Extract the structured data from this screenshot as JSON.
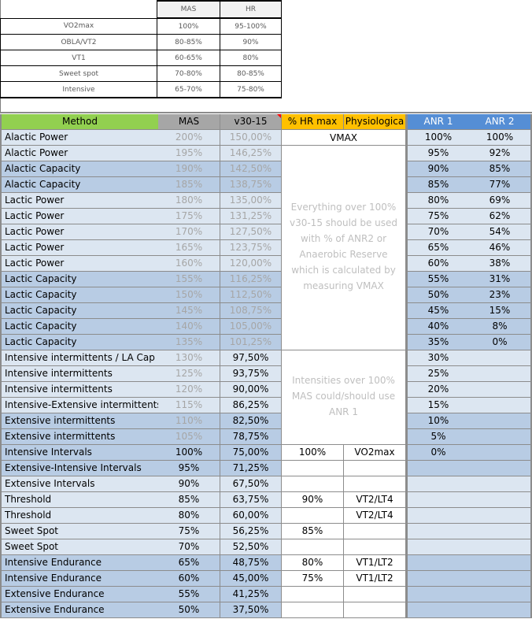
{
  "reference_table": {
    "headers": [
      "",
      "MAS",
      "HR"
    ],
    "rows": [
      {
        "label": "VO2max",
        "mas": "100%",
        "hr": "95-100%"
      },
      {
        "label": "OBLA/VT2",
        "mas": "80-85%",
        "hr": "90%"
      },
      {
        "label": "VT1",
        "mas": "60-65%",
        "hr": "80%"
      },
      {
        "label": "Sweet spot",
        "mas": "70-80%",
        "hr": "80-85%"
      },
      {
        "label": "Intensive",
        "mas": "65-70%",
        "hr": "75-80%"
      }
    ]
  },
  "main_table": {
    "headers": {
      "method": "Method",
      "mas": "MAS",
      "v30": "v30-15",
      "hr": "% HR max",
      "phys": "Physiologica",
      "anr1": "ANR 1",
      "anr2": "ANR 2"
    },
    "colors": {
      "method_header": "#92d050",
      "gray_header": "#a6a6a6",
      "orange_header": "#ffc000",
      "blue_header": "#558ed5",
      "row_light": "#dce6f1",
      "row_dark": "#b8cce4"
    },
    "merged_notes": {
      "vmax": "VMAX",
      "anr2_note": "Everything over 100% v30-15 should be used with % of ANR2 or Anaerobic Reserve which is calculated by measuring VMAX",
      "anr1_note": "Intensities over 100% MAS could/should use ANR 1"
    },
    "rows": [
      {
        "method": "Alactic Power",
        "mas": "200%",
        "v30": "150,00%",
        "hr": "",
        "phys": "",
        "anr1": "100%",
        "anr2": "100%",
        "shade": "light",
        "muted_mas": true,
        "muted_v30": true
      },
      {
        "method": "Alactic Power",
        "mas": "195%",
        "v30": "146,25%",
        "hr": "",
        "phys": "",
        "anr1": "95%",
        "anr2": "92%",
        "shade": "light",
        "muted_mas": true,
        "muted_v30": true
      },
      {
        "method": "Alactic Capacity",
        "mas": "190%",
        "v30": "142,50%",
        "hr": "",
        "phys": "",
        "anr1": "90%",
        "anr2": "85%",
        "shade": "dark",
        "muted_mas": true,
        "muted_v30": true
      },
      {
        "method": "Alactic Capacity",
        "mas": "185%",
        "v30": "138,75%",
        "hr": "",
        "phys": "",
        "anr1": "85%",
        "anr2": "77%",
        "shade": "dark",
        "muted_mas": true,
        "muted_v30": true
      },
      {
        "method": "Lactic Power",
        "mas": "180%",
        "v30": "135,00%",
        "hr": "",
        "phys": "",
        "anr1": "80%",
        "anr2": "69%",
        "shade": "light",
        "muted_mas": true,
        "muted_v30": true
      },
      {
        "method": "Lactic Power",
        "mas": "175%",
        "v30": "131,25%",
        "hr": "",
        "phys": "",
        "anr1": "75%",
        "anr2": "62%",
        "shade": "light",
        "muted_mas": true,
        "muted_v30": true
      },
      {
        "method": "Lactic Power",
        "mas": "170%",
        "v30": "127,50%",
        "hr": "",
        "phys": "",
        "anr1": "70%",
        "anr2": "54%",
        "shade": "light",
        "muted_mas": true,
        "muted_v30": true
      },
      {
        "method": "Lactic Power",
        "mas": "165%",
        "v30": "123,75%",
        "hr": "",
        "phys": "",
        "anr1": "65%",
        "anr2": "46%",
        "shade": "light",
        "muted_mas": true,
        "muted_v30": true
      },
      {
        "method": "Lactic Power",
        "mas": "160%",
        "v30": "120,00%",
        "hr": "",
        "phys": "",
        "anr1": "60%",
        "anr2": "38%",
        "shade": "light",
        "muted_mas": true,
        "muted_v30": true
      },
      {
        "method": "Lactic Capacity",
        "mas": "155%",
        "v30": "116,25%",
        "hr": "",
        "phys": "",
        "anr1": "55%",
        "anr2": "31%",
        "shade": "dark",
        "muted_mas": true,
        "muted_v30": true
      },
      {
        "method": "Lactic Capacity",
        "mas": "150%",
        "v30": "112,50%",
        "hr": "",
        "phys": "",
        "anr1": "50%",
        "anr2": "23%",
        "shade": "dark",
        "muted_mas": true,
        "muted_v30": true
      },
      {
        "method": "Lactic Capacity",
        "mas": "145%",
        "v30": "108,75%",
        "hr": "",
        "phys": "",
        "anr1": "45%",
        "anr2": "15%",
        "shade": "dark",
        "muted_mas": true,
        "muted_v30": true
      },
      {
        "method": "Lactic Capacity",
        "mas": "140%",
        "v30": "105,00%",
        "hr": "",
        "phys": "",
        "anr1": "40%",
        "anr2": "8%",
        "shade": "dark",
        "muted_mas": true,
        "muted_v30": true
      },
      {
        "method": "Lactic Capacity",
        "mas": "135%",
        "v30": "101,25%",
        "hr": "",
        "phys": "",
        "anr1": "35%",
        "anr2": "0%",
        "shade": "dark",
        "muted_mas": true,
        "muted_v30": true
      },
      {
        "method": "Intensive intermittents / LA Cap",
        "mas": "130%",
        "v30": "97,50%",
        "hr": "",
        "phys": "",
        "anr1": "30%",
        "anr2": "",
        "shade": "light",
        "muted_mas": true,
        "muted_v30": false
      },
      {
        "method": "Intensive intermittents",
        "mas": "125%",
        "v30": "93,75%",
        "hr": "",
        "phys": "",
        "anr1": "25%",
        "anr2": "",
        "shade": "light",
        "muted_mas": true,
        "muted_v30": false
      },
      {
        "method": "Intensive intermittents",
        "mas": "120%",
        "v30": "90,00%",
        "hr": "",
        "phys": "",
        "anr1": "20%",
        "anr2": "",
        "shade": "light",
        "muted_mas": true,
        "muted_v30": false
      },
      {
        "method": "Intensive-Extensive intermittents",
        "mas": "115%",
        "v30": "86,25%",
        "hr": "",
        "phys": "",
        "anr1": "15%",
        "anr2": "",
        "shade": "light",
        "muted_mas": true,
        "muted_v30": false
      },
      {
        "method": "Extensive intermittents",
        "mas": "110%",
        "v30": "82,50%",
        "hr": "",
        "phys": "",
        "anr1": "10%",
        "anr2": "",
        "shade": "dark",
        "muted_mas": true,
        "muted_v30": false
      },
      {
        "method": "Extensive intermittents",
        "mas": "105%",
        "v30": "78,75%",
        "hr": "",
        "phys": "",
        "anr1": "5%",
        "anr2": "",
        "shade": "dark",
        "muted_mas": true,
        "muted_v30": false
      },
      {
        "method": "Intensive Intervals",
        "mas": "100%",
        "v30": "75,00%",
        "hr": "100%",
        "phys": "VO2max",
        "anr1": "0%",
        "anr2": "",
        "shade": "dark",
        "muted_mas": false,
        "muted_v30": false
      },
      {
        "method": "Extensive-Intensive Intervals",
        "mas": "95%",
        "v30": "71,25%",
        "hr": "",
        "phys": "",
        "anr1": "",
        "anr2": "",
        "shade": "dark",
        "muted_mas": false,
        "muted_v30": false
      },
      {
        "method": "Extensive Intervals",
        "mas": "90%",
        "v30": "67,50%",
        "hr": "",
        "phys": "",
        "anr1": "",
        "anr2": "",
        "shade": "light",
        "muted_mas": false,
        "muted_v30": false
      },
      {
        "method": "Threshold",
        "mas": "85%",
        "v30": "63,75%",
        "hr": "90%",
        "phys": "VT2/LT4",
        "anr1": "",
        "anr2": "",
        "shade": "light",
        "muted_mas": false,
        "muted_v30": false
      },
      {
        "method": "Threshold",
        "mas": "80%",
        "v30": "60,00%",
        "hr": "",
        "phys": "VT2/LT4",
        "anr1": "",
        "anr2": "",
        "shade": "light",
        "muted_mas": false,
        "muted_v30": false
      },
      {
        "method": "Sweet Spot",
        "mas": "75%",
        "v30": "56,25%",
        "hr": "85%",
        "phys": "",
        "anr1": "",
        "anr2": "",
        "shade": "light",
        "muted_mas": false,
        "muted_v30": false
      },
      {
        "method": "Sweet Spot",
        "mas": "70%",
        "v30": "52,50%",
        "hr": "",
        "phys": "",
        "anr1": "",
        "anr2": "",
        "shade": "light",
        "muted_mas": false,
        "muted_v30": false
      },
      {
        "method": "Intensive Endurance",
        "mas": "65%",
        "v30": "48,75%",
        "hr": "80%",
        "phys": "VT1/LT2",
        "anr1": "",
        "anr2": "",
        "shade": "dark",
        "muted_mas": false,
        "muted_v30": false
      },
      {
        "method": "Intensive Endurance",
        "mas": "60%",
        "v30": "45,00%",
        "hr": "75%",
        "phys": "VT1/LT2",
        "anr1": "",
        "anr2": "",
        "shade": "dark",
        "muted_mas": false,
        "muted_v30": false
      },
      {
        "method": "Extensive Endurance",
        "mas": "55%",
        "v30": "41,25%",
        "hr": "",
        "phys": "",
        "anr1": "",
        "anr2": "",
        "shade": "dark",
        "muted_mas": false,
        "muted_v30": false
      },
      {
        "method": "Extensive Endurance",
        "mas": "50%",
        "v30": "37,50%",
        "hr": "",
        "phys": "",
        "anr1": "",
        "anr2": "",
        "shade": "dark",
        "muted_mas": false,
        "muted_v30": false
      }
    ]
  }
}
